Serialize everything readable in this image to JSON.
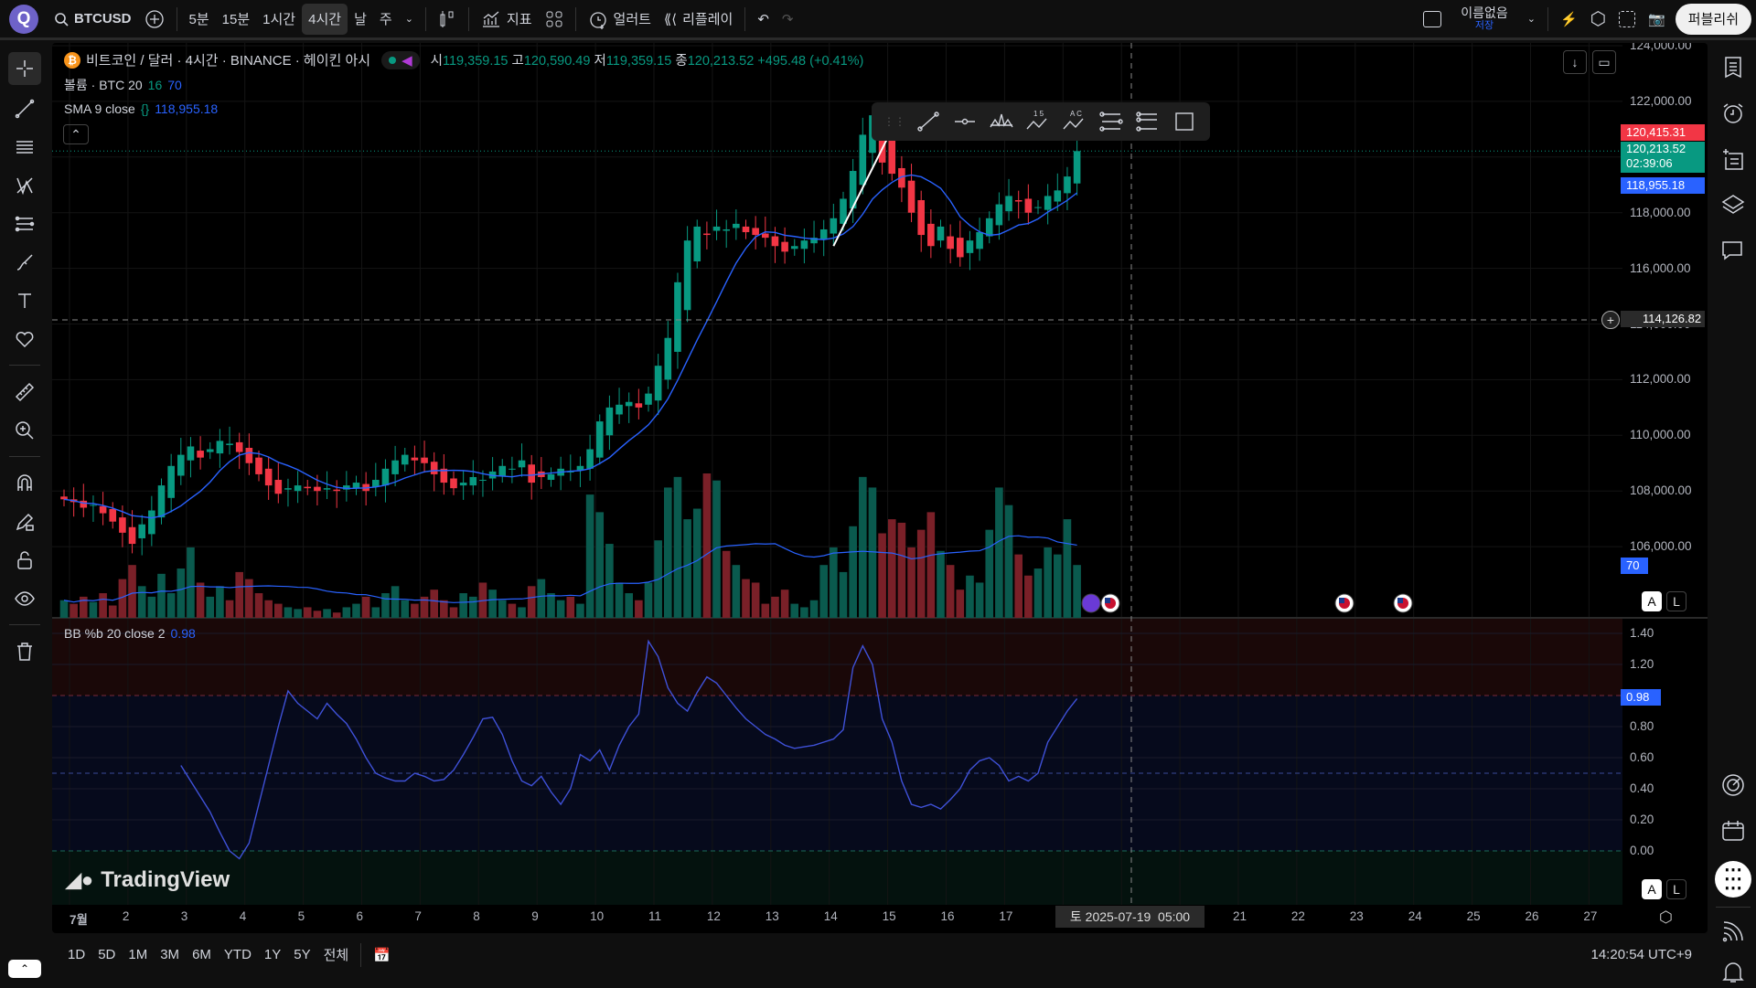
{
  "topbar": {
    "logo": "Q",
    "symbol": "BTCUSD",
    "intervals": [
      "5분",
      "15분",
      "1시간",
      "4시간",
      "날",
      "주"
    ],
    "active_interval": "4시간",
    "indicators": "지표",
    "alert": "얼러트",
    "replay": "리플레이",
    "layout_name": "이름없음",
    "layout_save": "저장",
    "publish": "퍼블리쉬"
  },
  "legend": {
    "title": "비트코인 / 달러 · 4시간 · BINANCE · 헤이킨 아시",
    "open_label": "시",
    "open": "119,359.15",
    "high_label": "고",
    "high": "120,590.49",
    "low_label": "저",
    "low": "119,359.15",
    "close_label": "종",
    "close": "120,213.52",
    "change": "+495.48 (+0.41%)",
    "volume_name": "볼륨 · BTC 20",
    "volume_v1": "16",
    "volume_v2": "70",
    "sma_name": "SMA 9 close",
    "sma_value": "118,955.18",
    "bb_name": "BB %b 20 close 2",
    "bb_value": "0.98"
  },
  "price_axis": {
    "ticks": [
      "124,000.00",
      "122,000.00",
      "120,000.00",
      "118,000.00",
      "116,000.00",
      "114,000.00",
      "112,000.00",
      "110,000.00",
      "108,000.00",
      "106,000.00"
    ],
    "high_label": "120,415.31",
    "last_price": "120,213.52",
    "countdown": "02:39:06",
    "sma_label": "118,955.18",
    "crosshair_price": "114,126.82",
    "volume_label": "70",
    "auto": "A",
    "log": "L"
  },
  "bb_axis": {
    "ticks": [
      "1.40",
      "1.20",
      "0.98",
      "0.80",
      "0.60",
      "0.40",
      "0.20",
      "0.00"
    ],
    "current": "0.98"
  },
  "time_axis": {
    "labels": [
      "7월",
      "2",
      "3",
      "4",
      "5",
      "6",
      "7",
      "8",
      "9",
      "10",
      "11",
      "12",
      "13",
      "14",
      "15",
      "16",
      "17",
      "21",
      "22",
      "23",
      "24",
      "25",
      "26",
      "27"
    ],
    "crosshair_time": "토 2025-07-19  05:00"
  },
  "bottombar": {
    "ranges": [
      "1D",
      "5D",
      "1M",
      "3M",
      "6M",
      "YTD",
      "1Y",
      "5Y",
      "전체"
    ],
    "clock": "14:20:54 UTC+9"
  },
  "watermark": "TradingView",
  "colors": {
    "up": "#089981",
    "down": "#f23645",
    "sma": "#2962ff",
    "bb": "#3f51d8"
  },
  "chart_data": {
    "type": "candlestick",
    "interval": "4h",
    "ylim": [
      105000,
      124500
    ],
    "closes": [
      107700,
      107600,
      107400,
      107500,
      107200,
      106900,
      106500,
      106100,
      106800,
      107300,
      108200,
      108900,
      109300,
      109600,
      109200,
      109500,
      109800,
      109700,
      109400,
      109000,
      108600,
      108200,
      107900,
      108100,
      108200,
      108100,
      108000,
      108100,
      108000,
      108200,
      108300,
      108000,
      108400,
      108800,
      109100,
      109300,
      109100,
      109000,
      108600,
      108300,
      108100,
      108300,
      108500,
      108400,
      108700,
      108900,
      108800,
      109100,
      108300,
      108500,
      108600,
      108800,
      108700,
      108900,
      109500,
      110500,
      111000,
      111100,
      111200,
      111000,
      111500,
      112500,
      113500,
      115500,
      117000,
      117500,
      117200,
      117500,
      117400,
      117600,
      117300,
      117200,
      117100,
      116800,
      116600,
      116800,
      117000,
      117100,
      117400,
      117800,
      118500,
      119500,
      120800,
      121500,
      119800,
      119400,
      118900,
      118000,
      117200,
      116800,
      117500,
      116700,
      116400,
      117000,
      117300,
      117800,
      118300,
      118600,
      118400,
      118000,
      118200,
      118600,
      118800,
      119300,
      120213.52
    ],
    "volumes": [
      10,
      8,
      12,
      9,
      14,
      7,
      22,
      30,
      18,
      12,
      25,
      14,
      28,
      40,
      20,
      12,
      18,
      10,
      26,
      22,
      14,
      10,
      8,
      6,
      5,
      6,
      4,
      5,
      3,
      6,
      8,
      12,
      6,
      14,
      18,
      10,
      8,
      12,
      16,
      10,
      6,
      14,
      12,
      20,
      16,
      10,
      8,
      6,
      18,
      22,
      14,
      10,
      12,
      8,
      70,
      60,
      42,
      20,
      14,
      10,
      20,
      44,
      74,
      80,
      56,
      62,
      82,
      78,
      38,
      30,
      22,
      20,
      8,
      12,
      16,
      8,
      6,
      10,
      30,
      40,
      26,
      52,
      80,
      74,
      48,
      56,
      54,
      40,
      50,
      60,
      38,
      30,
      16,
      24,
      20,
      50,
      74,
      64,
      36,
      24,
      28,
      40,
      36,
      56,
      30
    ],
    "bb_percent": [
      0.55,
      0.45,
      0.35,
      0.25,
      0.12,
      0.0,
      -0.05,
      0.05,
      0.3,
      0.55,
      0.8,
      1.03,
      0.95,
      0.9,
      0.85,
      0.95,
      0.88,
      0.82,
      0.72,
      0.6,
      0.5,
      0.47,
      0.45,
      0.45,
      0.5,
      0.48,
      0.45,
      0.46,
      0.52,
      0.62,
      0.73,
      0.85,
      0.86,
      0.75,
      0.58,
      0.45,
      0.42,
      0.48,
      0.38,
      0.3,
      0.4,
      0.62,
      0.58,
      0.65,
      0.52,
      0.68,
      0.8,
      0.88,
      1.35,
      1.25,
      1.05,
      0.95,
      0.9,
      1.02,
      1.12,
      1.08,
      1.0,
      0.92,
      0.85,
      0.8,
      0.75,
      0.72,
      0.68,
      0.66,
      0.67,
      0.68,
      0.7,
      0.72,
      0.78,
      1.18,
      1.32,
      1.2,
      0.85,
      0.7,
      0.45,
      0.3,
      0.28,
      0.3,
      0.27,
      0.33,
      0.4,
      0.52,
      0.58,
      0.6,
      0.55,
      0.45,
      0.48,
      0.45,
      0.5,
      0.7,
      0.8,
      0.9,
      0.98
    ],
    "trendline": {
      "from": {
        "index": 79,
        "price": 116800
      },
      "to": {
        "index": 86,
        "price": 121700
      }
    }
  }
}
